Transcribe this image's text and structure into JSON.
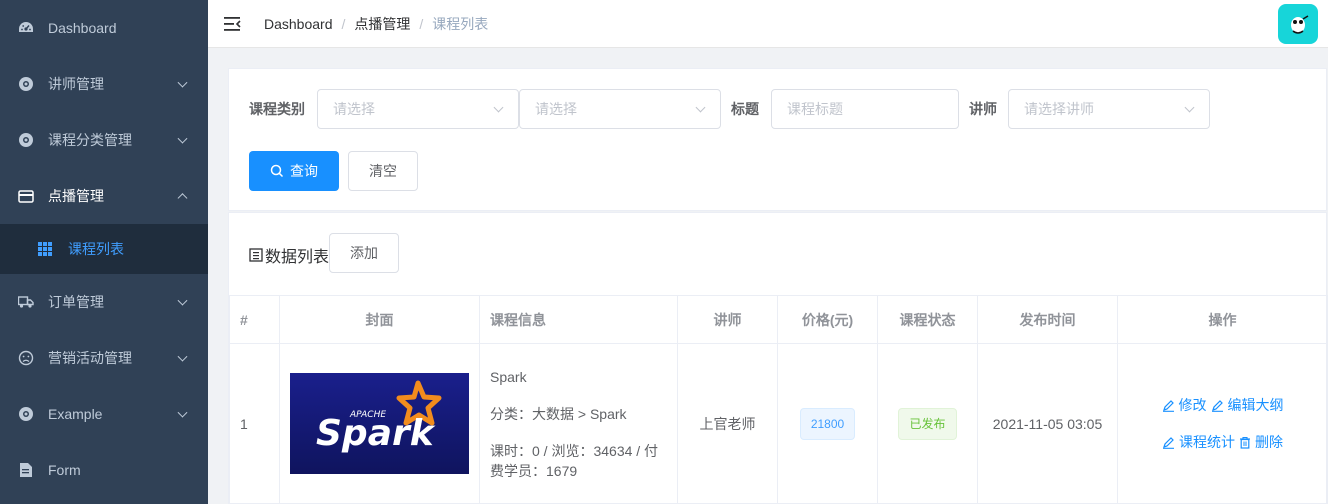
{
  "sidebar": {
    "items": [
      {
        "label": "Dashboard",
        "icon": "dashboard-icon",
        "has_arrow": false
      },
      {
        "label": "讲师管理",
        "icon": "help-circle-icon",
        "has_arrow": true
      },
      {
        "label": "课程分类管理",
        "icon": "help-circle-icon",
        "has_arrow": true
      },
      {
        "label": "点播管理",
        "icon": "credit-card-icon",
        "has_arrow": true,
        "open": true
      },
      {
        "label": "订单管理",
        "icon": "truck-icon",
        "has_arrow": true
      },
      {
        "label": "营销活动管理",
        "icon": "sad-face-icon",
        "has_arrow": true
      },
      {
        "label": "Example",
        "icon": "help-circle-icon",
        "has_arrow": true
      },
      {
        "label": "Form",
        "icon": "form-icon",
        "has_arrow": false
      }
    ],
    "active_sub": {
      "label": "课程列表",
      "icon": "grid-icon"
    }
  },
  "header": {
    "breadcrumb": [
      "Dashboard",
      "点播管理",
      "课程列表"
    ],
    "avatar_icon": "avatar-icon"
  },
  "search": {
    "category_label": "课程类别",
    "category_placeholder_1": "请选择",
    "category_placeholder_2": "请选择",
    "title_label": "标题",
    "title_placeholder": "课程标题",
    "teacher_label": "讲师",
    "teacher_placeholder": "请选择讲师",
    "query_button": "查询",
    "clear_button": "清空"
  },
  "list": {
    "title": "数据列表",
    "add_button": "添加",
    "columns": [
      "#",
      "封面",
      "课程信息",
      "讲师",
      "价格(元)",
      "课程状态",
      "发布时间",
      "操作"
    ],
    "rows": [
      {
        "index": "1",
        "cover_text_top": "APACHE",
        "cover_text_main": "Spark",
        "name": "Spark",
        "category": "分类：大数据 > Spark",
        "stats": "课时：0 / 浏览：34634 / 付费学员：1679",
        "teacher": "上官老师",
        "price": "21800",
        "status": "已发布",
        "publish_time": "2021-11-05 03:05",
        "ops": {
          "edit": "修改",
          "outline": "编辑大纲",
          "stats": "课程统计",
          "delete": "删除"
        }
      }
    ]
  },
  "colors": {
    "sidebar_bg": "#304156",
    "primary": "#1890ff",
    "accent_blue": "#409eff",
    "success": "#67c23a"
  }
}
